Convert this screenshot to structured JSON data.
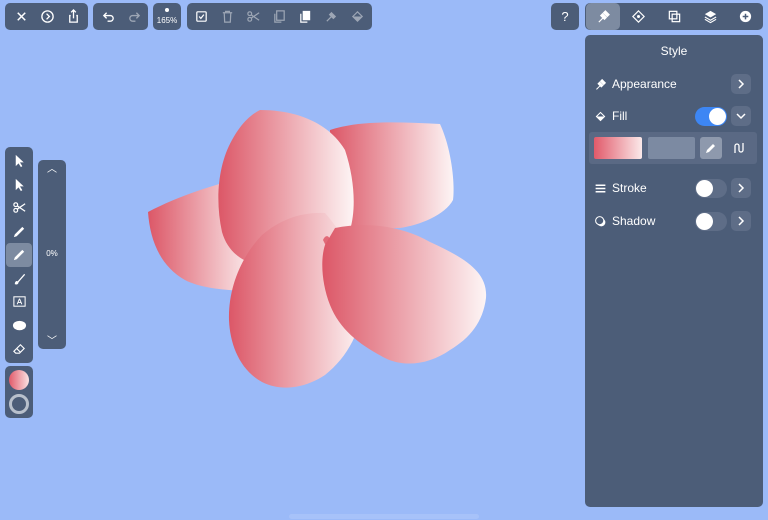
{
  "toolbar": {
    "zoom_label": "165%",
    "groups": [
      {
        "name": "file",
        "buttons": [
          "close-icon",
          "history-icon",
          "share-icon"
        ]
      },
      {
        "name": "history",
        "buttons": [
          "undo-icon",
          "redo-icon"
        ]
      },
      {
        "name": "zoom",
        "buttons": [
          "zoom-icon"
        ]
      },
      {
        "name": "edit",
        "buttons": [
          "select-all-icon",
          "trash-icon",
          "scissors-icon",
          "copy-icon",
          "paste-icon",
          "paste-style-icon",
          "paint-bucket-icon"
        ]
      }
    ],
    "help_label": "?",
    "tabs": [
      "style-tab",
      "arrange-tab",
      "boolean-tab",
      "layers-tab",
      "add-tab"
    ],
    "active_tab": "style-tab"
  },
  "left_tools": {
    "items": [
      "select-arrow-icon",
      "direct-select-icon",
      "scissors-icon",
      "pen-icon",
      "pencil-icon",
      "brush-icon",
      "text-icon",
      "ellipse-icon",
      "eraser-icon"
    ],
    "active": "pencil-icon"
  },
  "slider": {
    "value": "0%"
  },
  "panel": {
    "title": "Style",
    "appearance_label": "Appearance",
    "fill_label": "Fill",
    "fill_on": true,
    "stroke_label": "Stroke",
    "stroke_on": false,
    "shadow_label": "Shadow",
    "shadow_on": false
  },
  "colors": {
    "canvas": "#9bbaf8",
    "panel": "#4c5d78",
    "accent": "#3d86f4",
    "petal_dark": "#dc5767",
    "petal_light": "#fdf3f3"
  }
}
